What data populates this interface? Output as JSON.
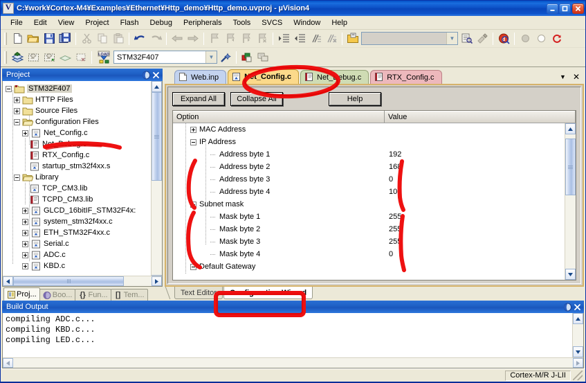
{
  "window": {
    "title": "C:¥work¥Cortex-M4¥Examples¥Ethernet¥Http_demo¥Http_demo.uvproj - µVision4",
    "minimize_label": "–",
    "maximize_label": "□",
    "close_label": "✕",
    "logo_icon": "uvision-logo-icon"
  },
  "menu": {
    "items": [
      {
        "label": "File"
      },
      {
        "label": "Edit"
      },
      {
        "label": "View"
      },
      {
        "label": "Project"
      },
      {
        "label": "Flash"
      },
      {
        "label": "Debug"
      },
      {
        "label": "Peripherals"
      },
      {
        "label": "Tools"
      },
      {
        "label": "SVCS"
      },
      {
        "label": "Window"
      },
      {
        "label": "Help"
      }
    ]
  },
  "toolbar1": {
    "icons": [
      "new-file-icon",
      "open-folder-icon",
      "save-icon",
      "save-all-icon",
      "cut-icon",
      "copy-icon",
      "paste-icon",
      "undo-icon",
      "redo-icon",
      "navigate-back-icon",
      "navigate-forward-icon",
      "bookmark-toggle-icon",
      "bookmark-prev-icon",
      "bookmark-next-icon",
      "bookmark-clear-icon",
      "indent-icon",
      "outdent-icon",
      "comment-icon",
      "uncomment-icon",
      "open-project-file-icon",
      "find-in-files-icon",
      "find-icon",
      "configure-debug-icon"
    ],
    "find_combo_value": "",
    "find_combo_placeholder": ""
  },
  "toolbar2": {
    "icons": [
      "build-target-icon",
      "build-all-icon",
      "rebuild-all-icon",
      "batch-build-icon",
      "stop-build-icon",
      "load-flash-icon",
      "target-options-icon",
      "manage-components-icon"
    ],
    "device_combo_value": "STM32F407",
    "magic_wand_icon": "magic-wand-icon"
  },
  "project_panel": {
    "title": "Project",
    "float_icon": "float-window-icon",
    "close_icon": "close-icon",
    "tree": [
      {
        "level": 0,
        "expander": "minus",
        "icon": "target-folder-icon",
        "label": "STM32F407",
        "selected": true
      },
      {
        "level": 1,
        "expander": "plus",
        "icon": "folder-icon",
        "label": "HTTP Files",
        "selected": false
      },
      {
        "level": 1,
        "expander": "plus",
        "icon": "folder-icon",
        "label": "Source Files",
        "selected": false
      },
      {
        "level": 1,
        "expander": "minus",
        "icon": "folder-open-icon",
        "label": "Configuration Files",
        "selected": false
      },
      {
        "level": 2,
        "expander": "plus",
        "icon": "c-source-icon",
        "label": "Net_Config.c",
        "selected": false
      },
      {
        "level": 2,
        "expander": "none",
        "icon": "c-source-dirty-icon",
        "label": "Net_Debug.c",
        "selected": false
      },
      {
        "level": 2,
        "expander": "none",
        "icon": "c-source-dirty-icon",
        "label": "RTX_Config.c",
        "selected": false
      },
      {
        "level": 2,
        "expander": "none",
        "icon": "asm-source-icon",
        "label": "startup_stm32f4xx.s",
        "selected": false
      },
      {
        "level": 1,
        "expander": "minus",
        "icon": "folder-open-icon",
        "label": "Library",
        "selected": false
      },
      {
        "level": 2,
        "expander": "none",
        "icon": "lib-file-icon",
        "label": "TCP_CM3.lib",
        "selected": false
      },
      {
        "level": 2,
        "expander": "none",
        "icon": "lib-dirty-icon",
        "label": "TCPD_CM3.lib",
        "selected": false
      },
      {
        "level": 2,
        "expander": "plus",
        "icon": "c-source-icon",
        "label": "GLCD_16bitIF_STM32F4x:",
        "selected": false
      },
      {
        "level": 2,
        "expander": "plus",
        "icon": "c-source-icon",
        "label": "system_stm32f4xx.c",
        "selected": false
      },
      {
        "level": 2,
        "expander": "plus",
        "icon": "c-source-icon",
        "label": "ETH_STM32F4xx.c",
        "selected": false
      },
      {
        "level": 2,
        "expander": "plus",
        "icon": "c-source-icon",
        "label": "Serial.c",
        "selected": false
      },
      {
        "level": 2,
        "expander": "plus",
        "icon": "c-source-icon",
        "label": "ADC.c",
        "selected": false
      },
      {
        "level": 2,
        "expander": "plus",
        "icon": "c-source-icon",
        "label": "KBD.c",
        "selected": false
      }
    ],
    "tabs": [
      {
        "label": "Proj...",
        "icon": "project-tab-icon",
        "active": true
      },
      {
        "label": "Boo...",
        "icon": "books-tab-icon",
        "active": false
      },
      {
        "label": "Fun...",
        "icon": "functions-tab-icon",
        "active": false
      },
      {
        "label": "Tem...",
        "icon": "templates-tab-icon",
        "active": false
      }
    ]
  },
  "editor": {
    "tabs": [
      {
        "label": "Web.inp",
        "icon": "text-file-icon",
        "active": false,
        "color": "#c3d3ef"
      },
      {
        "label": "Net_Config.c",
        "icon": "c-source-icon",
        "active": true,
        "color": "#fbd98a"
      },
      {
        "label": "Net_Debug.c",
        "icon": "c-source-icon",
        "active": false,
        "color": "#cfdcb4"
      },
      {
        "label": "RTX_Config.c",
        "icon": "c-source-icon",
        "active": false,
        "color": "#edb8bc"
      }
    ],
    "tabbar_dropdown_icon": "chevron-down-icon",
    "tabbar_close_icon": "close-icon",
    "bottom_tabs": [
      {
        "label": "Text Editor",
        "active": false
      },
      {
        "label": "Configuration Wizard",
        "active": true
      }
    ]
  },
  "wizard": {
    "buttons": {
      "expand_all": "Expand All",
      "collapse_all": "Collapse All",
      "help": "Help"
    },
    "columns": {
      "option": "Option",
      "value": "Value"
    },
    "rows": [
      {
        "indent": 1,
        "expander": "plus",
        "option": "MAC Address",
        "value": ""
      },
      {
        "indent": 1,
        "expander": "minus",
        "option": "IP Address",
        "value": ""
      },
      {
        "indent": 2,
        "expander": "leaf",
        "option": "Address byte 1",
        "value": "192"
      },
      {
        "indent": 2,
        "expander": "leaf",
        "option": "Address byte 2",
        "value": "168"
      },
      {
        "indent": 2,
        "expander": "leaf",
        "option": "Address byte 3",
        "value": "0"
      },
      {
        "indent": 2,
        "expander": "leaf",
        "option": "Address byte 4",
        "value": "100"
      },
      {
        "indent": 1,
        "expander": "minus",
        "option": "Subnet mask",
        "value": ""
      },
      {
        "indent": 2,
        "expander": "leaf",
        "option": "Mask byte 1",
        "value": "255"
      },
      {
        "indent": 2,
        "expander": "leaf",
        "option": "Mask byte 2",
        "value": "255"
      },
      {
        "indent": 2,
        "expander": "leaf",
        "option": "Mask byte 3",
        "value": "255"
      },
      {
        "indent": 2,
        "expander": "leaf",
        "option": "Mask byte 4",
        "value": "0"
      },
      {
        "indent": 1,
        "expander": "minus",
        "option": "Default Gateway",
        "value": ""
      }
    ]
  },
  "build_output": {
    "title": "Build Output",
    "float_icon": "float-window-icon",
    "close_icon": "close-icon",
    "lines": [
      "compiling ADC.c...",
      "compiling KBD.c...",
      "compiling LED.c..."
    ]
  },
  "status_bar": {
    "debugger": "Cortex-M/R J-LII"
  },
  "annotations": {
    "color": "#ee1111",
    "marks": [
      {
        "name": "net-config-tab-circle"
      },
      {
        "name": "net-config-tree-strike"
      },
      {
        "name": "ip-address-group-brace"
      },
      {
        "name": "ip-address-value-brace"
      },
      {
        "name": "subnet-mask-group-brace"
      },
      {
        "name": "subnet-mask-value-brace"
      },
      {
        "name": "configuration-wizard-tab-box"
      }
    ]
  }
}
